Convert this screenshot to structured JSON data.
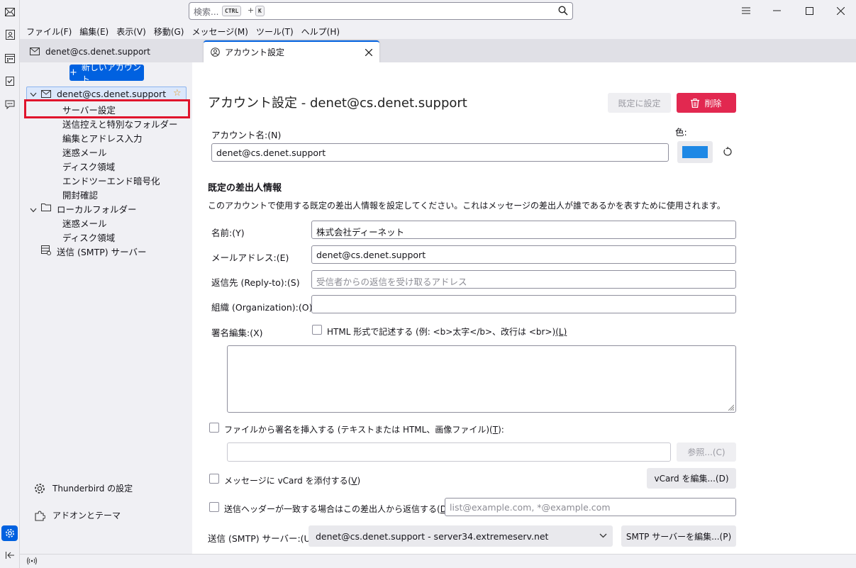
{
  "search": {
    "placeholder": "検索...",
    "key1": "CTRL",
    "plus": "+",
    "key2": "K"
  },
  "menu": [
    "ファイル(F)",
    "編集(E)",
    "表示(V)",
    "移動(G)",
    "メッセージ(M)",
    "ツール(T)",
    "ヘルプ(H)"
  ],
  "tabs": {
    "mail_tab": "denet@cs.denet.support",
    "settings_tab": "アカウント設定"
  },
  "sidebar": {
    "new_account": "新しいアカウント",
    "account_name": "denet@cs.denet.support",
    "account_items": [
      "サーバー設定",
      "送信控えと特別なフォルダー",
      "編集とアドレス入力",
      "迷惑メール",
      "ディスク領域",
      "エンドツーエンド暗号化",
      "開封確認"
    ],
    "local_folders": "ローカルフォルダー",
    "local_items": [
      "迷惑メール",
      "ディスク領域"
    ],
    "smtp": "送信 (SMTP) サーバー",
    "settings": "Thunderbird の設定",
    "addons": "アドオンとテーマ"
  },
  "main": {
    "heading": "アカウント設定 - denet@cs.denet.support",
    "default_btn": "既定に設定",
    "delete_btn": "削除",
    "account_name_label": "アカウント名:(N)",
    "account_name_value": "denet@cs.denet.support",
    "color_label": "色:",
    "color_value": "#1e88e5",
    "identity_heading": "既定の差出人情報",
    "identity_desc": "このアカウントで使用する既定の差出人情報を設定してください。これはメッセージの差出人が誰であるかを表すために使用されます。",
    "name_label": "名前:(Y)",
    "name_value": "株式会社ディーネット",
    "email_label": "メールアドレス:(E)",
    "email_value": "denet@cs.denet.support",
    "replyto_label": "返信先 (Reply-to):(S)",
    "replyto_placeholder": "受信者からの返信を受け取るアドレス",
    "org_label": "組織 (Organization):(O)",
    "org_value": "",
    "sig_label": "署名編集:(X)",
    "html_check": "HTML 形式で記述する (例: <b>太字</b>、改行は <br>)",
    "html_check_key": "(L)",
    "sigfile_check": "ファイルから署名を挿入する (テキストまたは HTML、画像ファイル)(",
    "sigfile_key": "T",
    "sigfile_end": "):",
    "browse_btn": "参照...(C)",
    "vcard_check": "メッセージに vCard を添付する(",
    "vcard_key": "V",
    "vcard_end": ")",
    "vcard_btn": "vCard を編集...(D)",
    "replyfrom_check": "送信ヘッダーが一致する場合はこの差出人から返信する(",
    "replyfrom_key": "D",
    "replyfrom_end": "):",
    "replyfrom_placeholder": "list@example.com, *@example.com",
    "smtp_label": "送信 (SMTP) サーバー:(U)",
    "smtp_value": "denet@cs.denet.support - server34.extremeserv.net",
    "smtp_btn": "SMTP サーバーを編集...(P)"
  }
}
